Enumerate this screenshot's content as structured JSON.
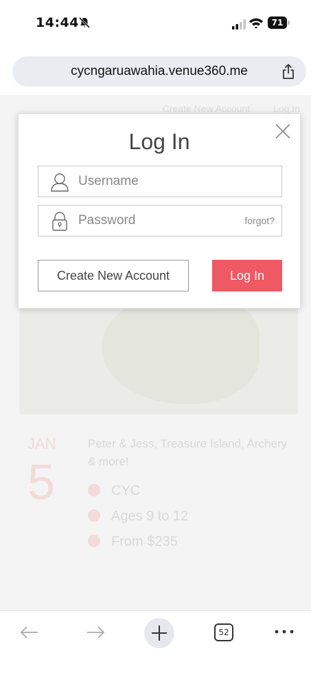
{
  "status_bar": {
    "time": "14:44",
    "battery": "71"
  },
  "browser": {
    "url": "cycngaruawahia.venue360.me",
    "tab_count": "52"
  },
  "background_page": {
    "top_links": [
      "Create New Account",
      "Log In"
    ],
    "event": {
      "month": "JAN",
      "day": "5",
      "title": "Peter & Jess, Treasure Island, Archery & more!",
      "venue": "CYC",
      "ages": "Ages 9 to 12",
      "price": "From $235"
    }
  },
  "login_modal": {
    "title": "Log In",
    "username_placeholder": "Username",
    "password_placeholder": "Password",
    "forgot_label": "forgot?",
    "create_account_label": "Create New Account",
    "login_label": "Log In"
  },
  "colors": {
    "accent": "#ee5964",
    "url_bar": "#e9edf2"
  }
}
